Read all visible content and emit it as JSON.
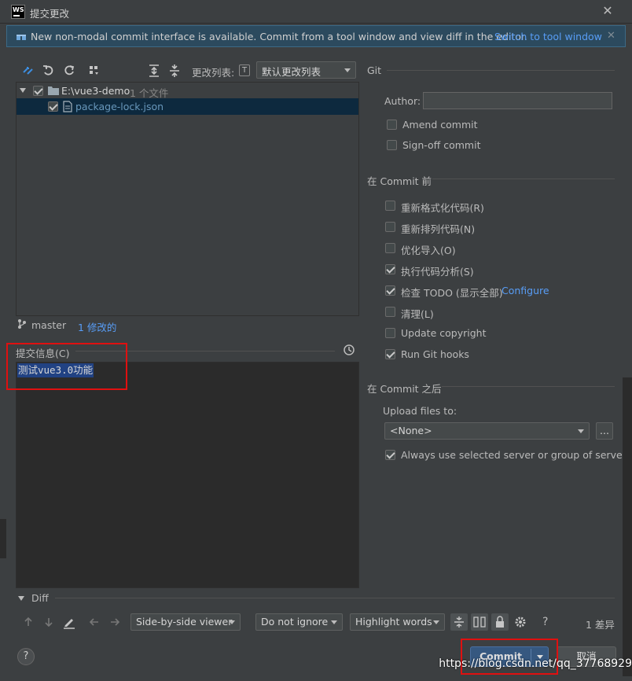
{
  "window": {
    "title": "提交更改",
    "logo_text": "WS"
  },
  "banner": {
    "text": "New non-modal commit interface is available. Commit from a tool window and view diff in the editor.",
    "link": "Switch to tool window"
  },
  "toolbar": {
    "changelist_label": "更改列表:",
    "changelist_shortcut": "T",
    "changelist_value": "默认更改列表"
  },
  "tree": {
    "root_path": "E:\\vue3-demo",
    "root_count": "1 个文件",
    "file_name": "package-lock.json"
  },
  "status": {
    "branch": "master",
    "modified": "1 修改的"
  },
  "message": {
    "label": "提交信息(C)",
    "text": "测试vue3.0功能"
  },
  "git": {
    "section": "Git",
    "author_label": "Author:",
    "author_value": "",
    "amend": "Amend commit",
    "signoff": "Sign-off commit"
  },
  "before_commit": {
    "title": "在 Commit 前",
    "items": [
      {
        "label": "重新格式化代码(R)",
        "checked": false
      },
      {
        "label": "重新排列代码(N)",
        "checked": false
      },
      {
        "label": "优化导入(O)",
        "checked": false
      },
      {
        "label": "执行代码分析(S)",
        "checked": true
      },
      {
        "label": "检查 TODO (显示全部)",
        "checked": true
      },
      {
        "label": "清理(L)",
        "checked": false
      },
      {
        "label": "Update copyright",
        "checked": false
      },
      {
        "label": "Run Git hooks",
        "checked": true
      }
    ],
    "configure_link": "Configure"
  },
  "after_commit": {
    "title": "在 Commit 之后",
    "upload_label": "Upload files to:",
    "upload_value": "<None>",
    "browse": "...",
    "always_use": "Always use selected server or group of servers"
  },
  "diff": {
    "title": "Diff",
    "viewer": "Side-by-side viewer",
    "ignore": "Do not ignore",
    "highlight": "Highlight words",
    "count": "1 差异"
  },
  "buttons": {
    "commit": "Commit",
    "cancel": "取消",
    "help": "?"
  },
  "watermark": "https://blog.csdn.net/qq_37768929",
  "colors": {
    "accent": "#365880",
    "link": "#589df6",
    "highlight_box": "#e01010",
    "selection": "#214283"
  }
}
